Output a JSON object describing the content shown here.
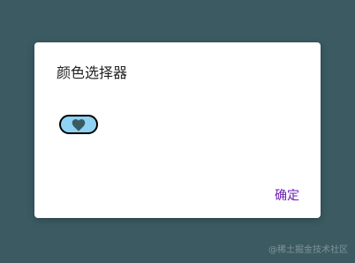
{
  "dialog": {
    "title": "颜色选择器",
    "selected_color": "#8ed3f3",
    "icon": "heart-icon",
    "confirm_label": "确定",
    "confirm_color": "#6a1bb4"
  },
  "watermark": {
    "text": "@稀土掘金技术社区"
  },
  "colors": {
    "background": "#3b5a62",
    "dialog_background": "#ffffff",
    "heart": "#3b5a62"
  }
}
